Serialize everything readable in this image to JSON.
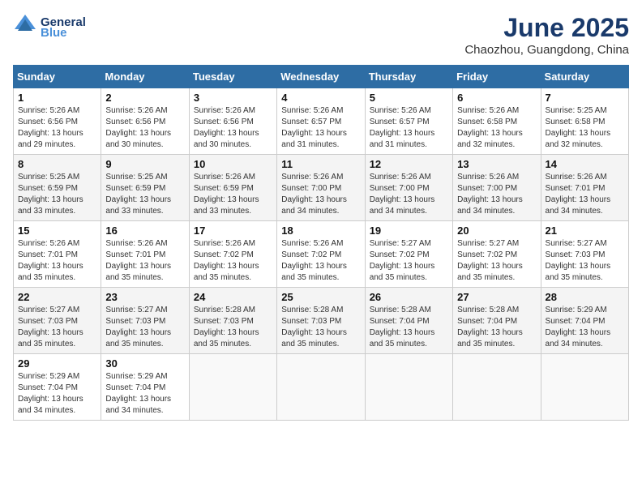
{
  "header": {
    "logo_line1": "General",
    "logo_line2": "Blue",
    "month_title": "June 2025",
    "location": "Chaozhou, Guangdong, China"
  },
  "weekdays": [
    "Sunday",
    "Monday",
    "Tuesday",
    "Wednesday",
    "Thursday",
    "Friday",
    "Saturday"
  ],
  "weeks": [
    [
      {
        "day": "1",
        "info": "Sunrise: 5:26 AM\nSunset: 6:56 PM\nDaylight: 13 hours\nand 29 minutes."
      },
      {
        "day": "2",
        "info": "Sunrise: 5:26 AM\nSunset: 6:56 PM\nDaylight: 13 hours\nand 30 minutes."
      },
      {
        "day": "3",
        "info": "Sunrise: 5:26 AM\nSunset: 6:56 PM\nDaylight: 13 hours\nand 30 minutes."
      },
      {
        "day": "4",
        "info": "Sunrise: 5:26 AM\nSunset: 6:57 PM\nDaylight: 13 hours\nand 31 minutes."
      },
      {
        "day": "5",
        "info": "Sunrise: 5:26 AM\nSunset: 6:57 PM\nDaylight: 13 hours\nand 31 minutes."
      },
      {
        "day": "6",
        "info": "Sunrise: 5:26 AM\nSunset: 6:58 PM\nDaylight: 13 hours\nand 32 minutes."
      },
      {
        "day": "7",
        "info": "Sunrise: 5:25 AM\nSunset: 6:58 PM\nDaylight: 13 hours\nand 32 minutes."
      }
    ],
    [
      {
        "day": "8",
        "info": "Sunrise: 5:25 AM\nSunset: 6:59 PM\nDaylight: 13 hours\nand 33 minutes."
      },
      {
        "day": "9",
        "info": "Sunrise: 5:25 AM\nSunset: 6:59 PM\nDaylight: 13 hours\nand 33 minutes."
      },
      {
        "day": "10",
        "info": "Sunrise: 5:26 AM\nSunset: 6:59 PM\nDaylight: 13 hours\nand 33 minutes."
      },
      {
        "day": "11",
        "info": "Sunrise: 5:26 AM\nSunset: 7:00 PM\nDaylight: 13 hours\nand 34 minutes."
      },
      {
        "day": "12",
        "info": "Sunrise: 5:26 AM\nSunset: 7:00 PM\nDaylight: 13 hours\nand 34 minutes."
      },
      {
        "day": "13",
        "info": "Sunrise: 5:26 AM\nSunset: 7:00 PM\nDaylight: 13 hours\nand 34 minutes."
      },
      {
        "day": "14",
        "info": "Sunrise: 5:26 AM\nSunset: 7:01 PM\nDaylight: 13 hours\nand 34 minutes."
      }
    ],
    [
      {
        "day": "15",
        "info": "Sunrise: 5:26 AM\nSunset: 7:01 PM\nDaylight: 13 hours\nand 35 minutes."
      },
      {
        "day": "16",
        "info": "Sunrise: 5:26 AM\nSunset: 7:01 PM\nDaylight: 13 hours\nand 35 minutes."
      },
      {
        "day": "17",
        "info": "Sunrise: 5:26 AM\nSunset: 7:02 PM\nDaylight: 13 hours\nand 35 minutes."
      },
      {
        "day": "18",
        "info": "Sunrise: 5:26 AM\nSunset: 7:02 PM\nDaylight: 13 hours\nand 35 minutes."
      },
      {
        "day": "19",
        "info": "Sunrise: 5:27 AM\nSunset: 7:02 PM\nDaylight: 13 hours\nand 35 minutes."
      },
      {
        "day": "20",
        "info": "Sunrise: 5:27 AM\nSunset: 7:02 PM\nDaylight: 13 hours\nand 35 minutes."
      },
      {
        "day": "21",
        "info": "Sunrise: 5:27 AM\nSunset: 7:03 PM\nDaylight: 13 hours\nand 35 minutes."
      }
    ],
    [
      {
        "day": "22",
        "info": "Sunrise: 5:27 AM\nSunset: 7:03 PM\nDaylight: 13 hours\nand 35 minutes."
      },
      {
        "day": "23",
        "info": "Sunrise: 5:27 AM\nSunset: 7:03 PM\nDaylight: 13 hours\nand 35 minutes."
      },
      {
        "day": "24",
        "info": "Sunrise: 5:28 AM\nSunset: 7:03 PM\nDaylight: 13 hours\nand 35 minutes."
      },
      {
        "day": "25",
        "info": "Sunrise: 5:28 AM\nSunset: 7:03 PM\nDaylight: 13 hours\nand 35 minutes."
      },
      {
        "day": "26",
        "info": "Sunrise: 5:28 AM\nSunset: 7:04 PM\nDaylight: 13 hours\nand 35 minutes."
      },
      {
        "day": "27",
        "info": "Sunrise: 5:28 AM\nSunset: 7:04 PM\nDaylight: 13 hours\nand 35 minutes."
      },
      {
        "day": "28",
        "info": "Sunrise: 5:29 AM\nSunset: 7:04 PM\nDaylight: 13 hours\nand 34 minutes."
      }
    ],
    [
      {
        "day": "29",
        "info": "Sunrise: 5:29 AM\nSunset: 7:04 PM\nDaylight: 13 hours\nand 34 minutes."
      },
      {
        "day": "30",
        "info": "Sunrise: 5:29 AM\nSunset: 7:04 PM\nDaylight: 13 hours\nand 34 minutes."
      },
      {
        "day": "",
        "info": ""
      },
      {
        "day": "",
        "info": ""
      },
      {
        "day": "",
        "info": ""
      },
      {
        "day": "",
        "info": ""
      },
      {
        "day": "",
        "info": ""
      }
    ]
  ]
}
